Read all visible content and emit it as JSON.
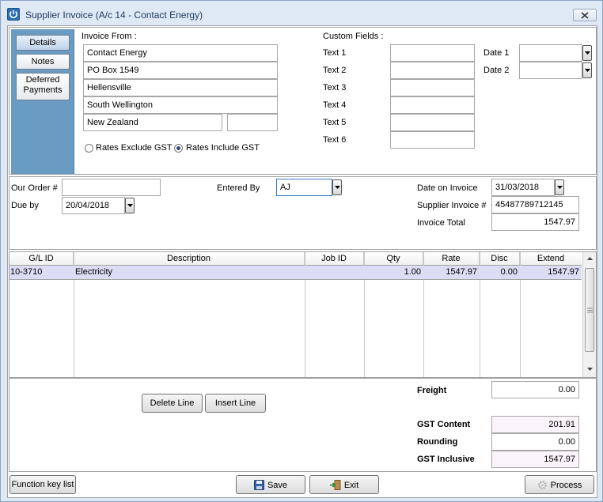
{
  "window": {
    "title": "Supplier Invoice (A/c 14 - Contact Energy)"
  },
  "side_tabs": [
    {
      "label": "Details"
    },
    {
      "label": "Notes"
    },
    {
      "label_line1": "Deferred",
      "label_line2": "Payments"
    }
  ],
  "invoice_from": {
    "heading": "Invoice From :",
    "lines": [
      "Contact Energy",
      "PO Box 1549",
      "Hellensville",
      "South Wellington",
      "New Zealand"
    ],
    "postcode": ""
  },
  "gst_options": {
    "exclude_label": "Rates Exclude GST",
    "include_label": "Rates Include GST",
    "selected": "include"
  },
  "custom_fields": {
    "heading": "Custom Fields  :",
    "texts": [
      {
        "label": "Text 1",
        "value": ""
      },
      {
        "label": "Text 2",
        "value": ""
      },
      {
        "label": "Text 3",
        "value": ""
      },
      {
        "label": "Text 4",
        "value": ""
      },
      {
        "label": "Text 5",
        "value": ""
      },
      {
        "label": "Text 6",
        "value": ""
      }
    ],
    "dates": [
      {
        "label": "Date 1",
        "value": ""
      },
      {
        "label": "Date 2",
        "value": ""
      }
    ]
  },
  "order": {
    "our_order_label": "Our Order #",
    "our_order_value": "",
    "due_by_label": "Due by",
    "due_by_value": "20/04/2018",
    "entered_by_label": "Entered By",
    "entered_by_value": "AJ",
    "date_on_invoice_label": "Date on Invoice",
    "date_on_invoice_value": "31/03/2018",
    "supplier_invoice_label": "Supplier Invoice #",
    "supplier_invoice_value": "45487789712145",
    "invoice_total_label": "Invoice Total",
    "invoice_total_value": "1547.97"
  },
  "lines_table": {
    "columns": [
      "G/L ID",
      "Description",
      "Job ID",
      "Qty",
      "Rate",
      "Disc",
      "Extend"
    ],
    "rows": [
      {
        "gl_id": "10-3710",
        "description": "Electricity",
        "job_id": "",
        "qty": "1.00",
        "rate": "1547.97",
        "disc": "0.00",
        "extend": "1547.97"
      }
    ]
  },
  "line_buttons": {
    "delete_label": "Delete Line",
    "insert_label": "Insert Line"
  },
  "totals": {
    "freight_label": "Freight",
    "freight_value": "0.00",
    "gst_content_label": "GST Content",
    "gst_content_value": "201.91",
    "rounding_label": "Rounding",
    "rounding_value": "0.00",
    "gst_inclusive_label": "GST Inclusive",
    "gst_inclusive_value": "1547.97"
  },
  "footer": {
    "function_key_label": "Function key list",
    "save_label": "Save",
    "exit_label": "Exit",
    "process_label": "Process"
  },
  "colors": {
    "side_panel": "#6a9bc3",
    "selected_row": "#dcdcf5",
    "title_text": "#1e395b"
  },
  "icons": {
    "app": "power-icon",
    "close": "close-icon",
    "save": "floppy-disk-icon",
    "exit": "exit-door-icon",
    "process": "gear-icon"
  }
}
